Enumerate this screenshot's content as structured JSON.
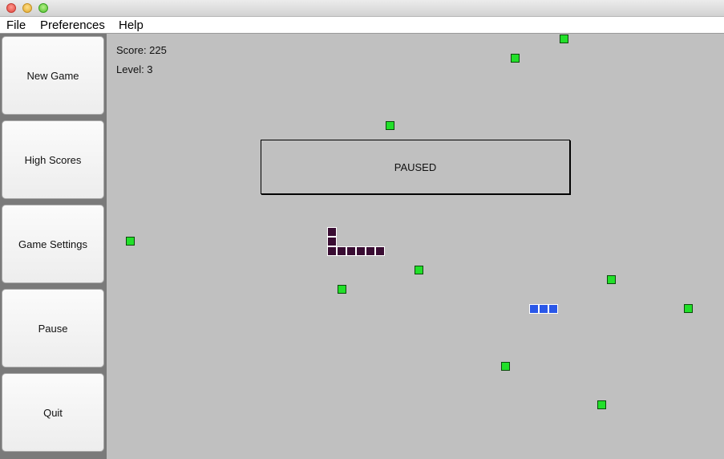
{
  "menu": {
    "items": [
      "File",
      "Preferences",
      "Help"
    ]
  },
  "sidebar": {
    "buttons": [
      "New Game",
      "High Scores",
      "Game Settings",
      "Pause",
      "Quit"
    ]
  },
  "hud": {
    "score_label": "Score: 225",
    "level_label": "Level: 3"
  },
  "overlay": {
    "status_text": "PAUSED"
  },
  "colors": {
    "board": "#c0c0c0",
    "food": "#22e02a",
    "player_snake": "#3a0d33",
    "rival_snake": "#2a57e8",
    "sidebar": "#7a7a7a"
  }
}
